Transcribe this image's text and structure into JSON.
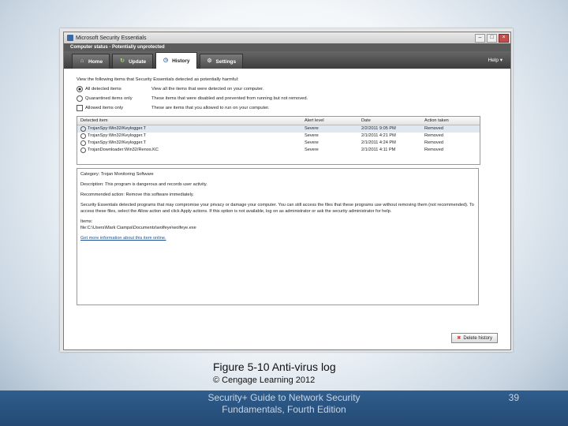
{
  "window": {
    "title": "Microsoft Security Essentials",
    "status": "Computer status - Potentially unprotected"
  },
  "tabs": [
    {
      "label": "Home",
      "icon": "home-icon"
    },
    {
      "label": "Update",
      "icon": "update-icon"
    },
    {
      "label": "History",
      "icon": "history-icon",
      "active": true
    },
    {
      "label": "Settings",
      "icon": "settings-icon"
    }
  ],
  "help": "Help ▾",
  "intro": "View the following items that Security Essentials detected as potentially harmful:",
  "filters": [
    {
      "label": "All detected items",
      "desc": "View all the items that were detected on your computer.",
      "type": "radio",
      "selected": true
    },
    {
      "label": "Quarantined items only",
      "desc": "These items that were disabled and prevented from running but not removed.",
      "type": "radio",
      "selected": false
    },
    {
      "label": "Allowed items only",
      "desc": "These are items that you allowed to run on your computer.",
      "type": "check",
      "selected": false
    }
  ],
  "table": {
    "headers": [
      "Detected item",
      "Alert level",
      "Date",
      "Action taken"
    ],
    "rows": [
      [
        "TrojanSpy:Win32/Keylogger.T",
        "Severe",
        "2/2/2011 9:05 PM",
        "Removed"
      ],
      [
        "TrojanSpy:Win32/Keylogger.T",
        "Severe",
        "2/1/2011 4:21 PM",
        "Removed"
      ],
      [
        "TrojanSpy:Win32/Keylogger.T",
        "Severe",
        "2/1/2011 4:24 PM",
        "Removed"
      ],
      [
        "TrojanDownloader:Win32/Renos.KC",
        "Severe",
        "2/1/2011 4:11 PM",
        "Removed"
      ]
    ]
  },
  "details": {
    "category": "Category: Trojan Monitoring Software",
    "description": "Description: This program is dangerous and records user activity.",
    "recommendation": "Recommended action: Remove this software immediately.",
    "body": "Security Essentials detected programs that may compromise your privacy or damage your computer. You can still access the files that these programs use without removing them (not recommended). To access these files, select the Allow action and click Apply actions. If this option is not available, log on as administrator or ask the security administrator for help.",
    "items_label": "Items:",
    "item_path": "file:C:\\Users\\Mark Ciampa\\Documents\\wolfeye\\wolfeye.exe",
    "more_link": "Get more information about this item online."
  },
  "delete_button": "Delete history",
  "caption": "Figure 5-10 Anti-virus log",
  "copyright": "© Cengage Learning 2012",
  "footer": {
    "book_title": "Security+ Guide to Network Security Fundamentals, Fourth Edition",
    "page": "39"
  }
}
